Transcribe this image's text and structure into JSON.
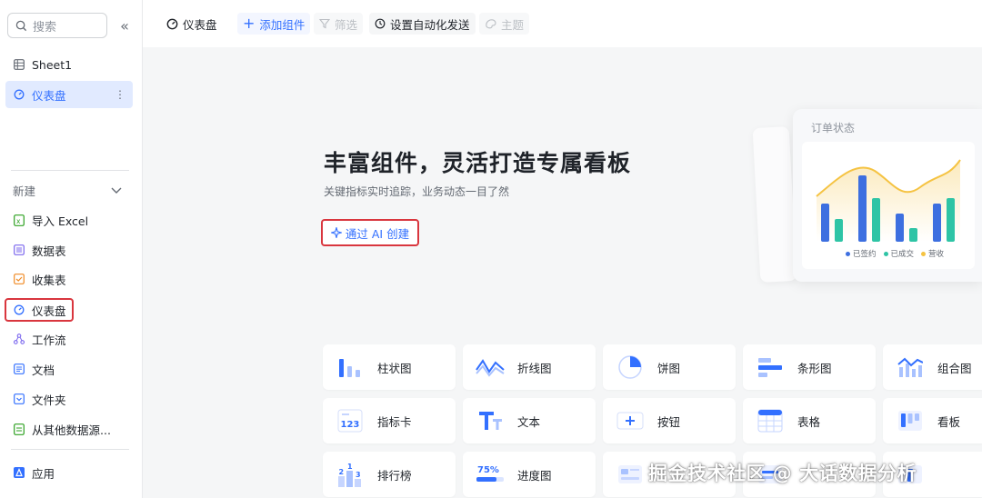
{
  "sidebar": {
    "search_placeholder": "搜索",
    "collapse_glyph": "«",
    "top_items": [
      {
        "label": "Sheet1"
      },
      {
        "label": "仪表盘"
      }
    ],
    "more_glyph": "⋮",
    "new_section": "新建",
    "create_items": [
      {
        "label": "导入 Excel"
      },
      {
        "label": "数据表"
      },
      {
        "label": "收集表"
      },
      {
        "label": "仪表盘"
      },
      {
        "label": "工作流"
      },
      {
        "label": "文档"
      },
      {
        "label": "文件夹"
      },
      {
        "label": "从其他数据源..."
      }
    ],
    "apps_label": "应用"
  },
  "topbar": {
    "dashboard_label": "仪表盘",
    "add_component": "添加组件",
    "filter": "筛选",
    "auto_send": "设置自动化发送",
    "theme": "主题"
  },
  "hero": {
    "title": "丰富组件，灵活打造专属看板",
    "subtitle": "关键指标实时追踪，业务动态一目了然",
    "ai_button": "通过 AI 创建"
  },
  "preview": {
    "title": "订单状态",
    "legend": [
      {
        "label": "已签约",
        "color": "#3d6fe0"
      },
      {
        "label": "已成交",
        "color": "#2ec4a5"
      },
      {
        "label": "营收",
        "color": "#f5c342"
      }
    ]
  },
  "components": [
    {
      "label": "柱状图",
      "icon": "bar-chart-icon"
    },
    {
      "label": "折线图",
      "icon": "line-chart-icon"
    },
    {
      "label": "饼图",
      "icon": "pie-chart-icon"
    },
    {
      "label": "条形图",
      "icon": "horizontal-bar-icon"
    },
    {
      "label": "组合图",
      "icon": "combo-chart-icon"
    },
    {
      "label": "指标卡",
      "icon": "metric-card-icon"
    },
    {
      "label": "文本",
      "icon": "text-icon"
    },
    {
      "label": "按钮",
      "icon": "plus-button-icon"
    },
    {
      "label": "表格",
      "icon": "table-icon"
    },
    {
      "label": "看板",
      "icon": "kanban-icon"
    },
    {
      "label": "排行榜",
      "icon": "ranking-icon"
    },
    {
      "label": "进度图",
      "icon": "progress-icon"
    }
  ],
  "progress_icon_text": "75%",
  "metric_icon_text": "123",
  "watermark": "掘金技术社区 @ 大话数据分析"
}
